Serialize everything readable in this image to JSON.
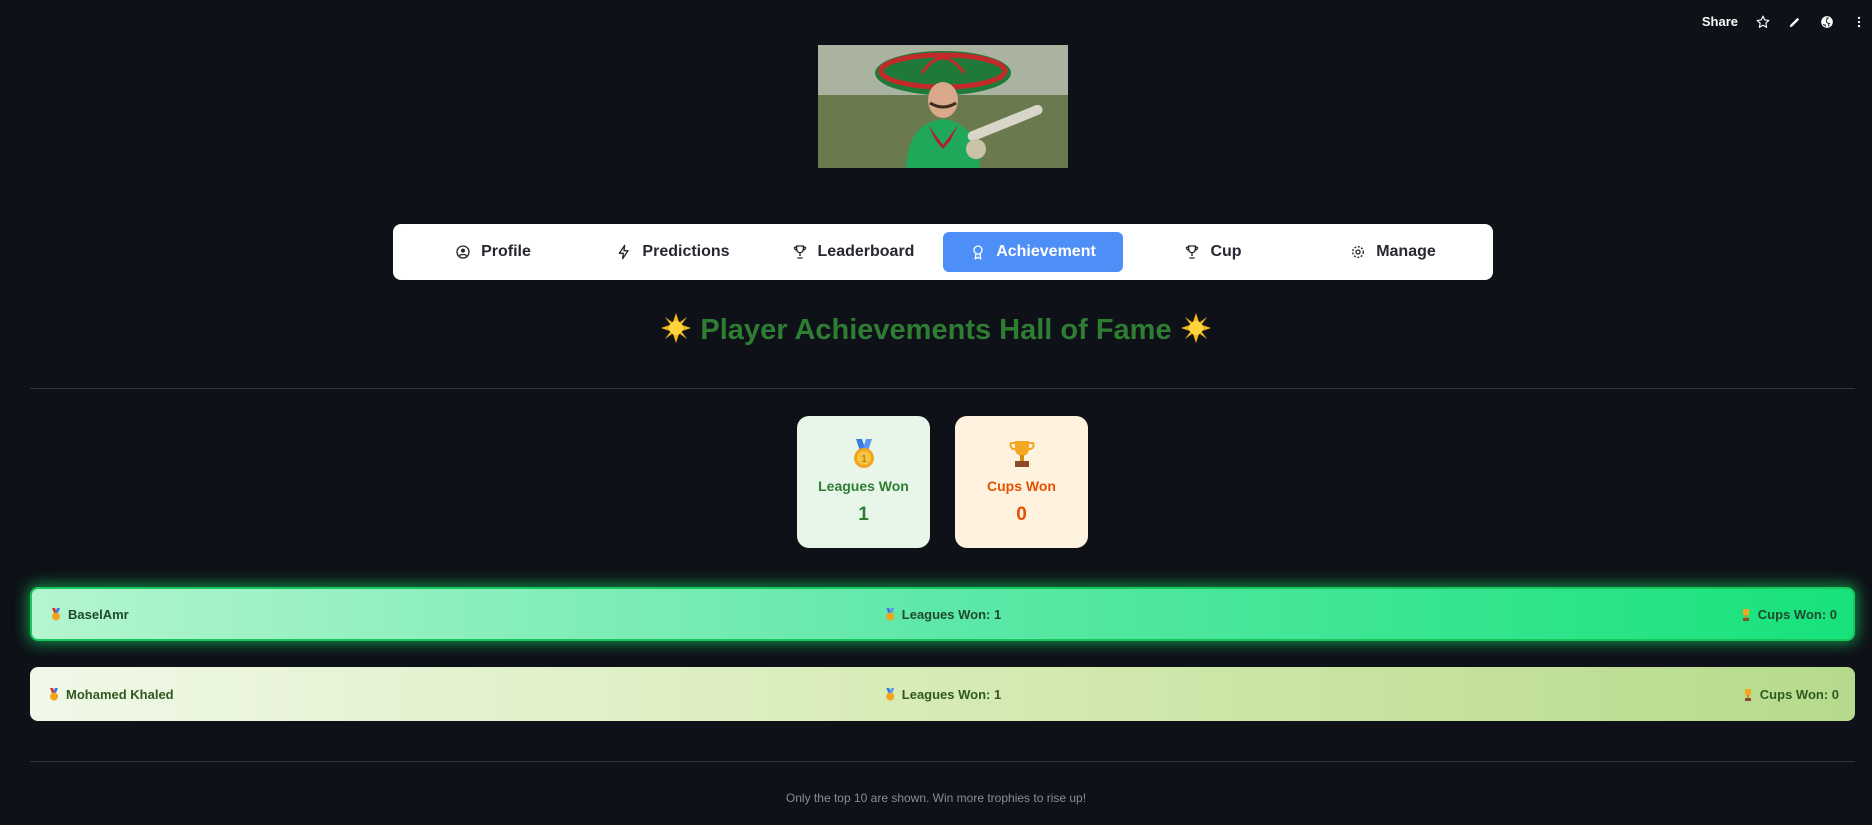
{
  "toolbar": {
    "share_label": "Share",
    "icons": [
      "star-icon",
      "edit-icon",
      "github-icon",
      "more-icon"
    ]
  },
  "nav": {
    "items": [
      {
        "label": "Profile",
        "icon": "user-circle-icon"
      },
      {
        "label": "Predictions",
        "icon": "lightning-icon"
      },
      {
        "label": "Leaderboard",
        "icon": "trophy-icon"
      },
      {
        "label": "Achievement",
        "icon": "award-icon",
        "active": true
      },
      {
        "label": "Cup",
        "icon": "trophy-icon"
      },
      {
        "label": "Manage",
        "icon": "gear-icon"
      }
    ],
    "active_color": "#4e8ff7"
  },
  "title": {
    "text": "Player Achievements Hall of Fame",
    "color": "#2e7d32"
  },
  "stats": {
    "leagues": {
      "label": "Leagues Won",
      "value": "1",
      "icon": "medal-icon"
    },
    "cups": {
      "label": "Cups Won",
      "value": "0",
      "icon": "trophy-icon"
    }
  },
  "players": [
    {
      "name": "BaselAmr",
      "leagues": "Leagues Won: 1",
      "cups": "Cups Won: 0",
      "highlighted": true
    },
    {
      "name": "Mohamed Khaled",
      "leagues": "Leagues Won: 1",
      "cups": "Cups Won: 0",
      "highlighted": false
    }
  ],
  "footer": {
    "text": "Only the top 10 are shown. Win more trophies to rise up!"
  }
}
